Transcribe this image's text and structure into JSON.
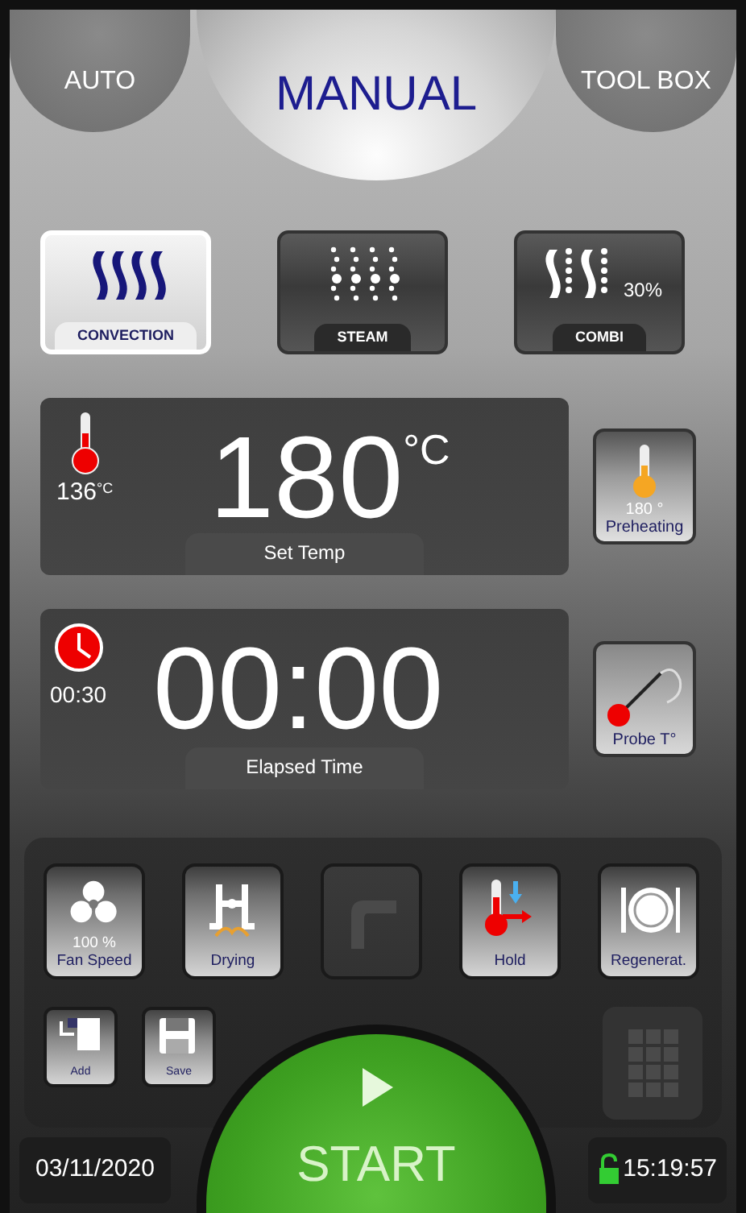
{
  "tabs": [
    {
      "label": "AUTO",
      "selected": false
    },
    {
      "label": "MANUAL",
      "selected": true
    },
    {
      "label": "TOOL BOX",
      "selected": false
    }
  ],
  "modes": [
    {
      "kind": "convection",
      "label": "CONVECTION",
      "selected": true
    },
    {
      "kind": "steam",
      "label": "STEAM",
      "selected": false
    },
    {
      "kind": "combi",
      "label": "COMBI",
      "selected": false,
      "value": "30%"
    }
  ],
  "temperature": {
    "current": "136",
    "current_unit": "°C",
    "set": "180",
    "unit": "°C",
    "label": "Set Temp"
  },
  "preheating": {
    "value": "180 °",
    "label": "Preheating"
  },
  "timer": {
    "remaining": "00:30",
    "elapsed": "00:00",
    "label": "Elapsed Time"
  },
  "probe": {
    "label": "Probe T°"
  },
  "functions": [
    {
      "kind": "fan",
      "value": "100 %",
      "label": "Fan Speed",
      "disabled": false
    },
    {
      "kind": "drying",
      "label": "Drying",
      "disabled": false
    },
    {
      "kind": "faucet",
      "disabled": true
    },
    {
      "kind": "hold",
      "label": "Hold",
      "disabled": false
    },
    {
      "kind": "plate",
      "label": "Regenerat.",
      "disabled": false
    }
  ],
  "actions": [
    {
      "kind": "add",
      "label": "Add"
    },
    {
      "kind": "save",
      "label": "Save"
    }
  ],
  "keypad": {
    "disabled": true
  },
  "start": {
    "label": "START"
  },
  "status_bar": {
    "date": "03/11/2020",
    "locked": false,
    "time": "15:19:57"
  }
}
